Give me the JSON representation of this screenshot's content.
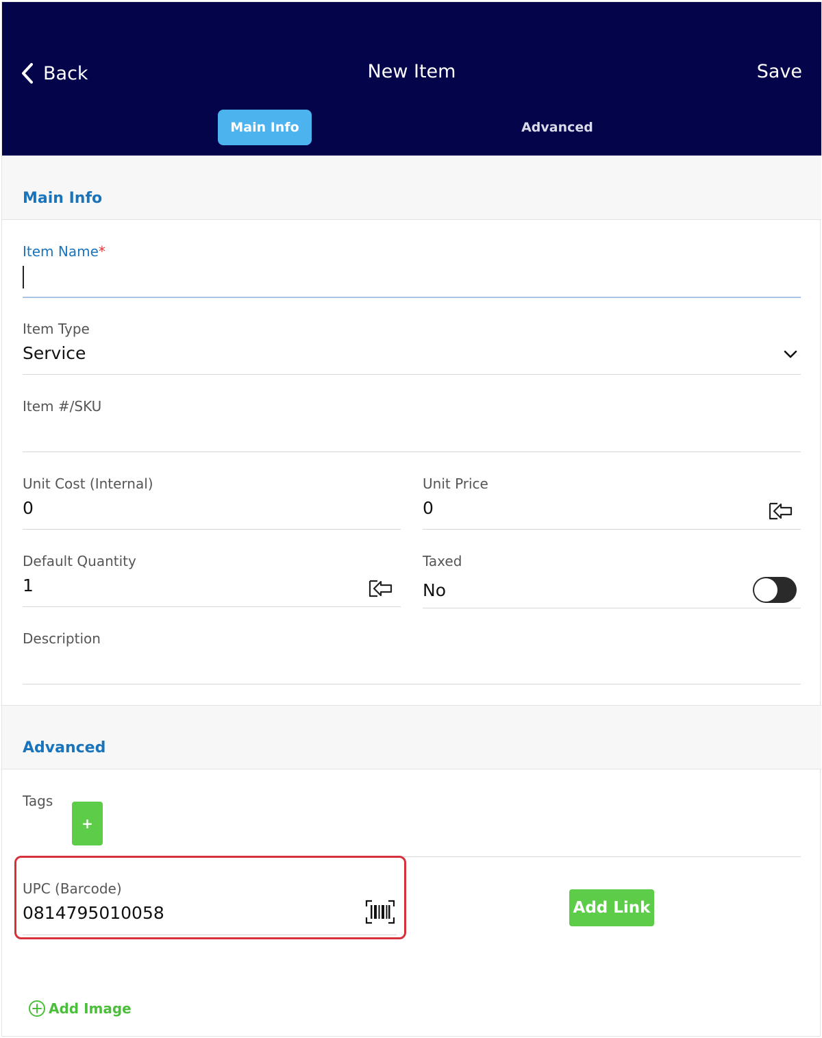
{
  "header": {
    "back_label": "Back",
    "title": "New Item",
    "save_label": "Save",
    "tabs": [
      {
        "label": "Main Info",
        "active": true
      },
      {
        "label": "Advanced",
        "active": false
      }
    ],
    "background_color": "#03044a",
    "active_tab_color": "#4db3ef"
  },
  "main_info": {
    "section_title": "Main Info",
    "item_name": {
      "label": "Item Name",
      "required_mark": "*",
      "value": ""
    },
    "item_type": {
      "label": "Item Type",
      "value": "Service"
    },
    "sku": {
      "label": "Item #/SKU",
      "value": ""
    },
    "unit_cost": {
      "label": "Unit Cost (Internal)",
      "value": "0"
    },
    "unit_price": {
      "label": "Unit Price",
      "value": "0"
    },
    "default_quantity": {
      "label": "Default Quantity",
      "value": "1"
    },
    "taxed": {
      "label": "Taxed",
      "value": "No",
      "toggle_on": false
    },
    "description": {
      "label": "Description",
      "value": ""
    }
  },
  "advanced": {
    "section_title": "Advanced",
    "tags": {
      "label": "Tags",
      "add_label": "+"
    },
    "upc": {
      "label": "UPC (Barcode)",
      "value": "0814795010058"
    },
    "add_link_label": "Add Link",
    "add_image_label": "Add Image"
  },
  "colors": {
    "section_title": "#1a74bb",
    "green_button": "#5ccc49",
    "highlight_border": "#d6303a"
  },
  "icons": {
    "back": "chevron-left-icon",
    "dropdown": "chevron-down-icon",
    "apply": "apply-arrow-icon",
    "barcode": "barcode-scan-icon",
    "add_image": "plus-circle-icon"
  }
}
